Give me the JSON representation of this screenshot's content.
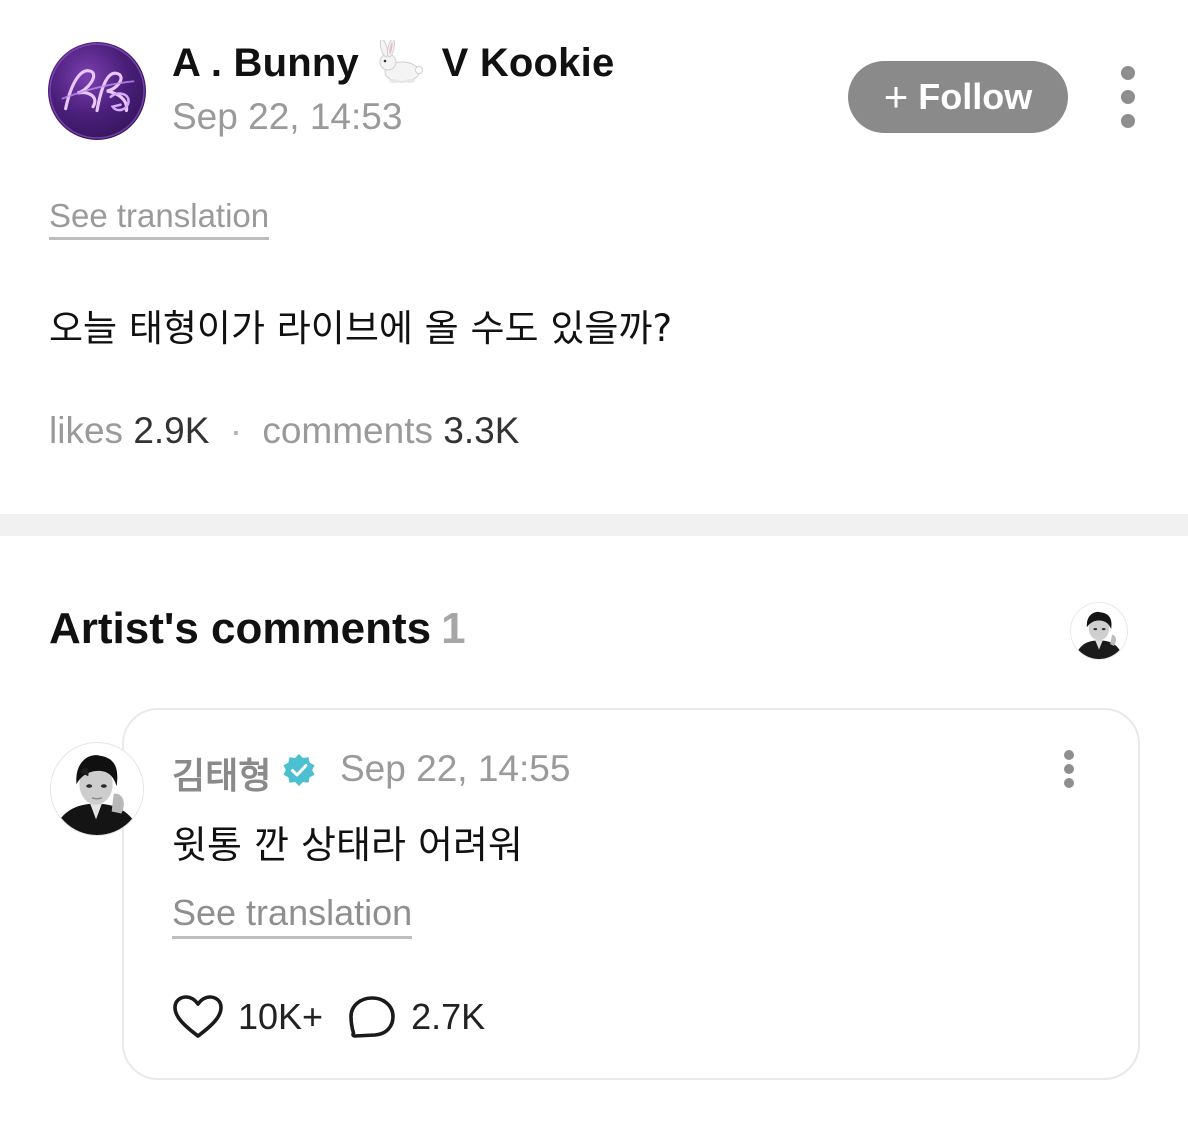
{
  "post": {
    "author_prefix": "A . Bunny",
    "author_suffix": "V Kookie",
    "author_emoji": "rabbit-icon",
    "timestamp": "Sep 22, 14:53",
    "follow_plus": "+",
    "follow_label": "Follow",
    "see_translation": "See translation",
    "body": "오늘 태형이가 라이브에 올 수도 있을까?",
    "stats": {
      "likes_label": "likes",
      "likes_value": "2.9K",
      "separator": "·",
      "comments_label": "comments",
      "comments_value": "3.3K"
    }
  },
  "artist_comments": {
    "title": "Artist's comments",
    "count": "1",
    "comment": {
      "author": "김태형",
      "verified": "verified-badge-icon",
      "timestamp": "Sep 22, 14:55",
      "body": "윗통 깐 상태라 어려워",
      "see_translation": "See translation",
      "likes": "10K+",
      "replies": "2.7K"
    }
  },
  "colors": {
    "follow_button_bg": "#8a8a8a",
    "secondary_text": "#9a9a9a",
    "verified_badge": "#4cc0d0",
    "divider": "#f1f1f1",
    "card_border": "#e9e9e9"
  },
  "icons": [
    "post-avatar-logo",
    "rabbit-icon",
    "more-options-icon",
    "verified-badge-icon",
    "heart-icon",
    "comment-bubble-icon",
    "artist-avatar"
  ]
}
